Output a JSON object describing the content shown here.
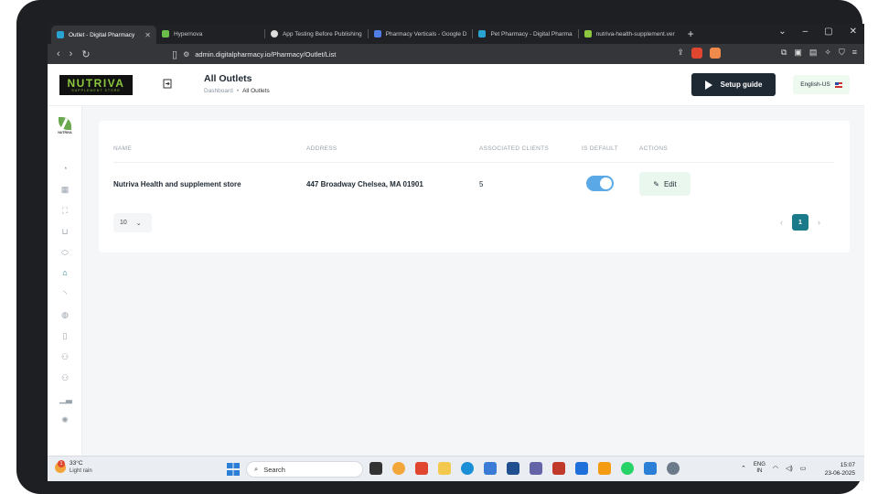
{
  "browser": {
    "tabs": [
      {
        "title": "Outlet - Digital Pharmacy",
        "active": true,
        "color": "#29a3d1"
      },
      {
        "title": "Hypernova",
        "active": false,
        "color": "#6abf4b"
      },
      {
        "title": "App Testing Before Publishing",
        "active": false,
        "color": "#dddddd"
      },
      {
        "title": "Pharmacy Verticals - Google D",
        "active": false,
        "color": "#4f7fe6"
      },
      {
        "title": "Pet Pharmacy - Digital Pharma",
        "active": false,
        "color": "#29a3d1"
      },
      {
        "title": "nutriva-health-supplement.ver",
        "active": false,
        "color": "#8dc63f"
      }
    ],
    "url": "admin.digitalpharmacy.io/Pharmacy/Outlet/List"
  },
  "header": {
    "brand_name": "NUTRIVA",
    "brand_sub": "SUPPLEMENT STORE",
    "title": "All Outlets",
    "breadcrumb": [
      "Dashboard",
      "All Outlets"
    ],
    "setup_label": "Setup guide",
    "lang_label": "English-US"
  },
  "sidebar": {
    "logo_label": "NUTRIVA",
    "items": [
      "dashboard",
      "grid",
      "scan",
      "cart",
      "pill",
      "bank",
      "feed",
      "globe",
      "clipboard",
      "users",
      "users-2",
      "chart",
      "settings"
    ],
    "active_index": 5
  },
  "table": {
    "columns": [
      "NAME",
      "ADDRESS",
      "ASSOCIATED CLIENTS",
      "IS DEFAULT",
      "ACTIONS"
    ],
    "rows": [
      {
        "name": "Nutriva Health and supplement store",
        "address": "447 Broadway Chelsea, MA 01901",
        "clients": "5",
        "is_default": true,
        "action": "Edit"
      }
    ],
    "per_page": "10",
    "current_page": "1"
  },
  "taskbar": {
    "weather_temp": "33°C",
    "weather_cond": "Light rain",
    "weather_badge": "1",
    "search_placeholder": "Search",
    "lang_top": "ENG",
    "lang_bottom": "IN",
    "time": "15:07",
    "date": "23-06-2025",
    "app_colors": [
      "#333333",
      "#f3a73b",
      "#e0462f",
      "#f2c94c",
      "#1a8fd6",
      "#3a7bd5",
      "#1f4f8f",
      "#6264a7",
      "#c0392b",
      "#1e6fd9",
      "#f39c12",
      "#25d366",
      "#2b7fd6",
      "#6c7a89"
    ]
  }
}
